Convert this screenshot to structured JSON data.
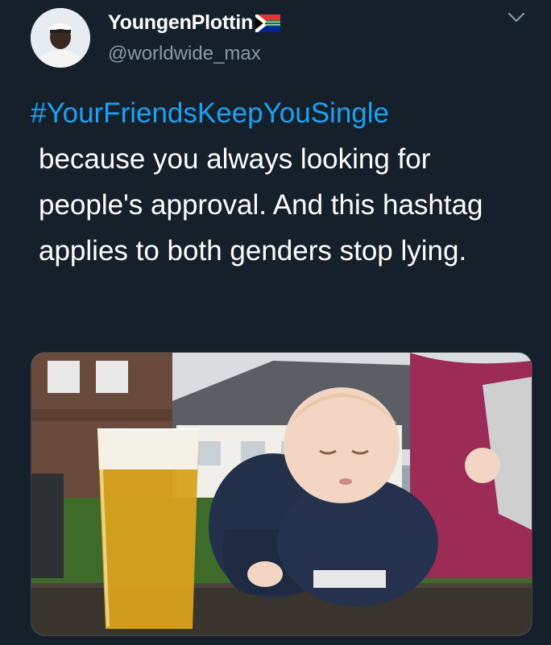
{
  "tweet": {
    "author": {
      "display_name": "YoungenPlottin",
      "handle": "@worldwide_max",
      "flag_icon": "south-africa-flag-icon",
      "avatar_icon": "profile-avatar"
    },
    "hashtag": "#YourFriendsKeepYouSingle",
    "body": "because you always looking for people's approval. And this hashtag applies to both genders stop lying.",
    "media_description_icon": "baby-beer-photo",
    "menu_icon": "chevron-down-icon"
  },
  "colors": {
    "background": "#15202b",
    "text": "#ffffff",
    "secondary_text": "#8899a6",
    "link": "#1da1f2"
  }
}
